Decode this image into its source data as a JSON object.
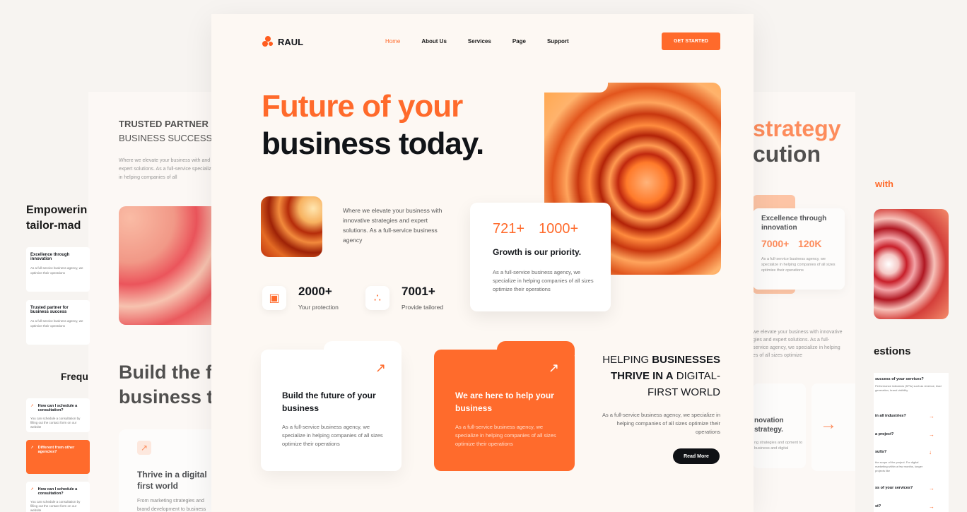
{
  "nav": {
    "brand": "RAUL",
    "items": [
      "Home",
      "About Us",
      "Services",
      "Page",
      "Support"
    ],
    "cta": "GET STARTED"
  },
  "hero": {
    "line1": "Future of your",
    "line2": "business today.",
    "description": "Where we elevate your business with innovative strategies and expert solutions. As a full-service business agency",
    "stats": [
      {
        "value": "2000+",
        "label": "Your protection"
      },
      {
        "value": "7001+",
        "label": "Provide tailored"
      }
    ]
  },
  "growth": {
    "stat1": "721+",
    "stat2": "1000+",
    "title": "Growth is our priority.",
    "desc": "As a full-service business agency, we specialize in helping companies of all sizes optimize their operations"
  },
  "features": [
    {
      "title": "Build the future of your business",
      "desc": "As a full-service business agency, we specialize in helping companies of all sizes optimize their operations"
    },
    {
      "title": "We are here to help your business",
      "desc": "As a full-service business agency, we specialize in helping companies of all sizes optimize their operations"
    }
  ],
  "helping": {
    "l1a": "HELPING ",
    "l1b": "BUSINESSES",
    "l2a": "THRIVE IN A",
    "l2b": " DIGITAL-",
    "l3": "FIRST WORLD",
    "desc": "As a full-service business agency, we specialize in helping companies of all sizes optimize their operations",
    "button": "Read More"
  },
  "left_bg": {
    "trusted1": "TRUSTED PARTNER",
    "trusted2": "BUSINESS SUCCESS",
    "desc": "Where we elevate your business with and expert solutions. As a full-service specialize in helping companies of all",
    "empower1": "Empowerin",
    "empower2": "tailor-mad",
    "card1": "Excellence through innovation",
    "card2": "Trusted partner for business success",
    "cardtext": "As a full-service business agency, we optimize their operations",
    "freq": "Frequ",
    "build1": "Build the f",
    "build2": "business t",
    "faq1": "How can I schedule a consultation?",
    "faq2": "Different from other agencies?",
    "faq3": "How can I schedule a consultation?",
    "faqtext": "You can schedule a consultation by filling out the contact form on our website",
    "thrive": "Thrive in a digital first world",
    "thrive_desc": "From marketing strategies and brand development to business"
  },
  "right_bg": {
    "strategy": "strategy",
    "cution": "cution",
    "with": "with",
    "card_title": "Excellence through innovation",
    "n1": "7000+",
    "n2": "120K",
    "card_desc": "As a full-service business agency, we specialize in helping companies of all sizes optimize their operations",
    "desc": "we elevate your business with innovative gies and expert solutions. As a full-service agency, we specialize in helping es of all sizes optimize",
    "estions": "estions",
    "innov1": "novation",
    "innov2": "strategy.",
    "innov_desc": "ng strategies and opment to business and digital",
    "q1": "success of your services?",
    "q1text": "Performance indicators (KPIs) such as revenue, lead generation, brand visibility",
    "q2": "in all industries?",
    "q3": "a project?",
    "q4": "sults?",
    "q4text": "the scope of the project. For digital marketing within a few months, longer projects like",
    "q5": "ss of your services?",
    "q6": "st?"
  }
}
